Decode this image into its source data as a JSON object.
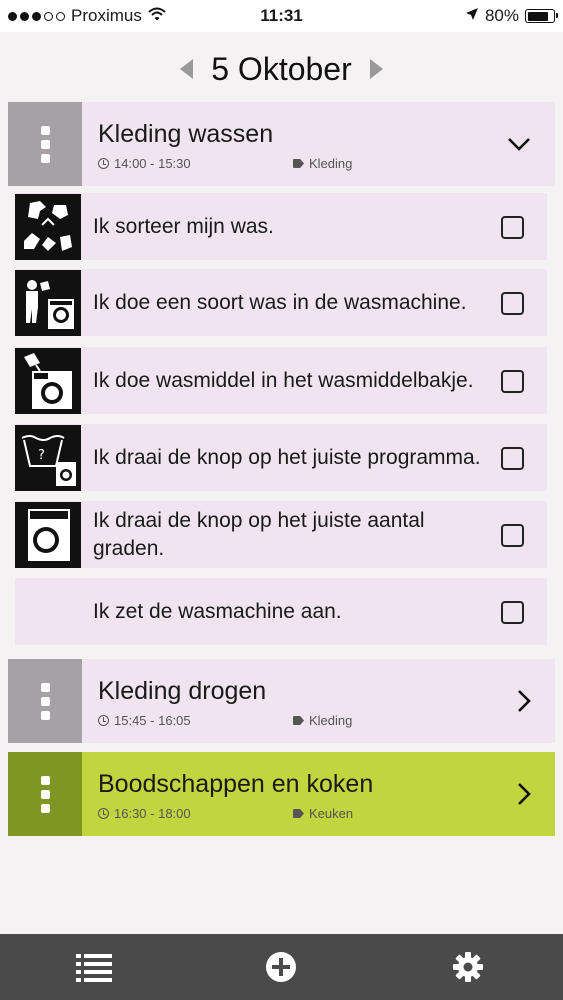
{
  "status": {
    "carrier": "Proximus",
    "time": "11:31",
    "battery": "80%",
    "battery_level": 0.8,
    "signal_bars": 5,
    "signal_filled": 3
  },
  "date_nav": {
    "label": "5 Oktober"
  },
  "tasks": [
    {
      "title": "Kleding wassen",
      "time": "14:00 - 15:30",
      "tag": "Kleding",
      "expanded": true,
      "color": "#f0e4f0",
      "handle_color": "#a6a1a4"
    },
    {
      "title": "Kleding drogen",
      "time": "15:45 - 16:05",
      "tag": "Kleding",
      "expanded": false,
      "color": "#f0e4f0",
      "handle_color": "#a6a1a4"
    },
    {
      "title": "Boodschappen en koken",
      "time": "16:30 - 18:00",
      "tag": "Keuken",
      "expanded": false,
      "color": "#c0d53e",
      "handle_color": "#7f9624"
    }
  ],
  "steps": [
    {
      "text": "Ik sorteer mijn was.",
      "icon": "sorting-laundry-pictogram",
      "checked": false
    },
    {
      "text": "Ik doe een soort was in de wasmachine.",
      "icon": "loading-washer-pictogram",
      "checked": false
    },
    {
      "text": "Ik doe wasmiddel in het wasmiddelbakje.",
      "icon": "detergent-pictogram",
      "checked": false
    },
    {
      "text": "Ik draai de knop op het juiste programma.",
      "icon": "program-dial-pictogram",
      "checked": false
    },
    {
      "text": "Ik draai de knop op het juiste aantal graden.",
      "icon": "washing-machine-pictogram",
      "checked": false
    },
    {
      "text": "Ik zet de wasmachine aan.",
      "icon": "",
      "checked": false
    }
  ],
  "tab_bar": {
    "items": [
      "list-icon",
      "add-icon",
      "settings-icon"
    ],
    "background": "#4a4a4a"
  }
}
